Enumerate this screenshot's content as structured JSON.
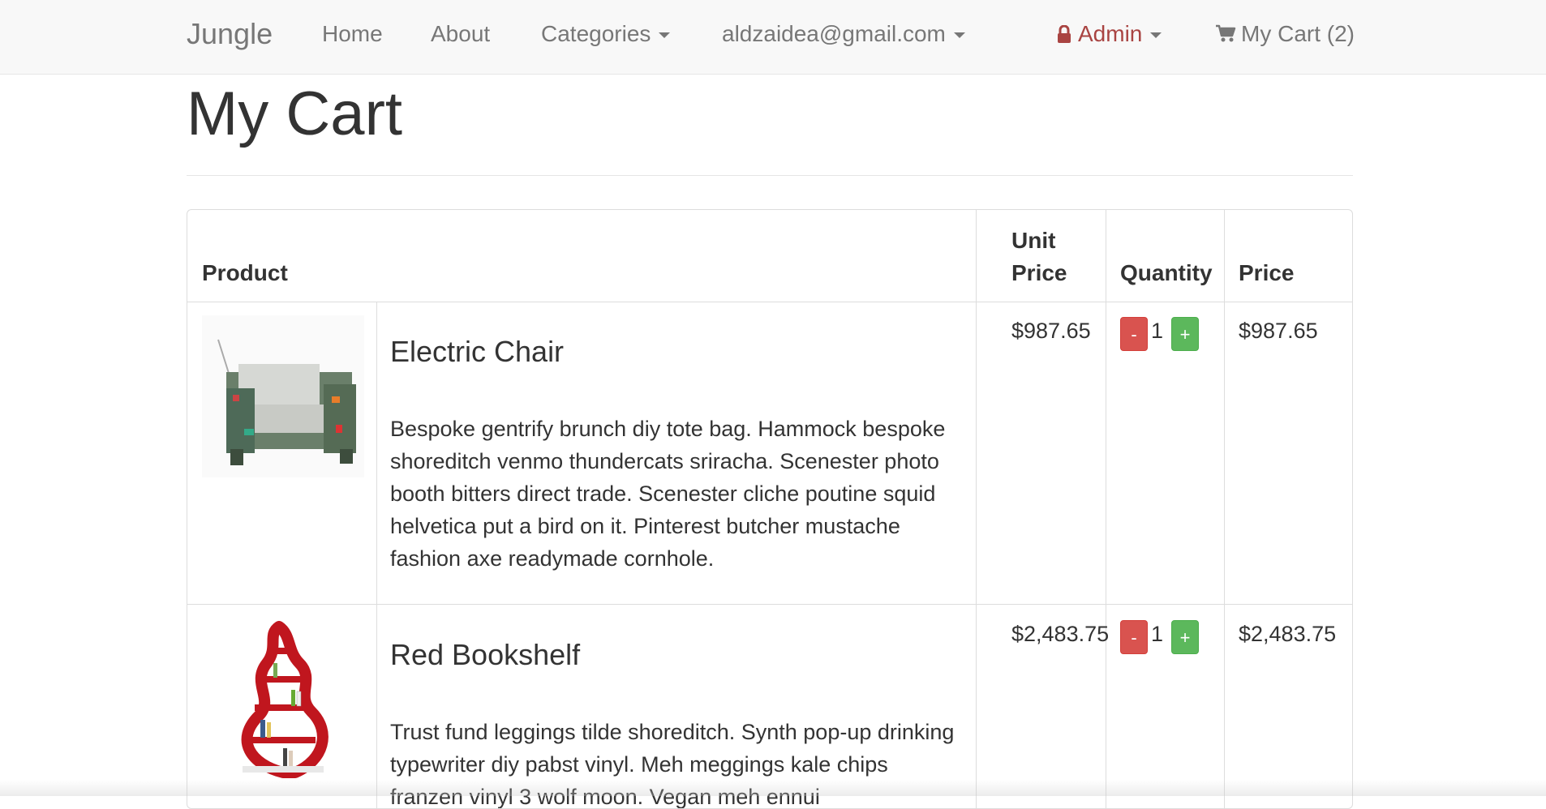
{
  "navbar": {
    "brand": "Jungle",
    "home": "Home",
    "about": "About",
    "categories": "Categories",
    "user_email": "aldzaidea@gmail.com",
    "admin": "Admin",
    "cart": "My Cart (2)"
  },
  "page": {
    "title": "My Cart"
  },
  "table": {
    "headers": {
      "product": "Product",
      "unit_price_line1": "Unit",
      "unit_price_line2": "Price",
      "quantity": "Quantity",
      "price": "Price"
    },
    "rows": [
      {
        "name": "Electric Chair",
        "description": "Bespoke gentrify brunch diy tote bag. Hammock bespoke shoreditch venmo thundercats sriracha. Scenester photo booth bitters direct trade. Scenester cliche poutine squid helvetica put a bird on it. Pinterest butcher mustache fashion axe readymade cornhole.",
        "unit_price": "$987.65",
        "quantity": "1",
        "price": "$987.65",
        "minus_label": "-",
        "plus_label": "+",
        "image": "electric-chair-image"
      },
      {
        "name": "Red Bookshelf",
        "description": "Trust fund leggings tilde shoreditch. Synth pop-up drinking typewriter diy pabst vinyl. Meh meggings kale chips franzen vinyl 3 wolf moon. Vegan meh ennui",
        "unit_price": "$2,483.75",
        "quantity": "1",
        "price": "$2,483.75",
        "minus_label": "-",
        "plus_label": "+",
        "image": "red-bookshelf-image"
      }
    ]
  },
  "colors": {
    "admin": "#a94442",
    "minus_button": "#d9534f",
    "plus_button": "#5cb85c"
  }
}
